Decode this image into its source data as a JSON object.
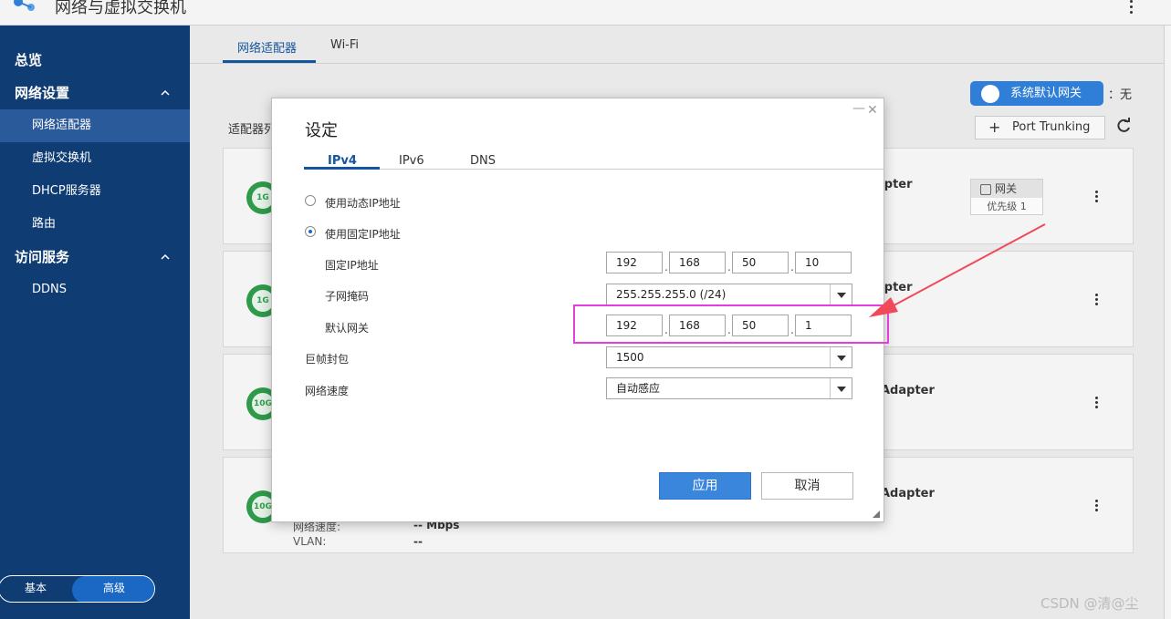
{
  "app": {
    "title": "网络与虚拟交换机"
  },
  "sidebar": {
    "items": [
      {
        "label": "总览"
      },
      {
        "label": "网络设置"
      },
      {
        "label": "网络适配器"
      },
      {
        "label": "虚拟交换机"
      },
      {
        "label": "DHCP服务器"
      },
      {
        "label": "路由"
      },
      {
        "label": "访问服务"
      },
      {
        "label": "DDNS"
      }
    ],
    "mode": {
      "basic": "基本",
      "advanced": "高级"
    }
  },
  "main": {
    "tabs": [
      {
        "label": "网络适配器"
      },
      {
        "label": "Wi-Fi"
      }
    ],
    "default_gateway_label": "系统默认网关",
    "default_gateway_value": "：无",
    "port_trunking_label": "Port Trunking",
    "list_title": "适配器列",
    "cards": [
      {
        "badge": "1G",
        "name": "apter",
        "chip_label": "网关",
        "chip_priority": "优先级 1"
      },
      {
        "badge": "1G",
        "name": "apter"
      },
      {
        "badge": "10G",
        "name": "Adapter"
      },
      {
        "badge": "10G",
        "name": "Adapter",
        "speed_label": "网络速度:",
        "speed_value": "-- Mbps",
        "vlan_label": "VLAN:",
        "vlan_value": "--"
      }
    ]
  },
  "modal": {
    "title": "设定",
    "tabs": [
      {
        "label": "IPv4"
      },
      {
        "label": "IPv6"
      },
      {
        "label": "DNS"
      }
    ],
    "options": {
      "dynamic": "使用动态IP地址",
      "static": "使用固定IP地址"
    },
    "fields": {
      "fixed_ip_label": "固定IP地址",
      "fixed_ip": [
        "192",
        "168",
        "50",
        "10"
      ],
      "subnet_label": "子网掩码",
      "subnet_value": "255.255.255.0 (/24)",
      "gateway_label": "默认网关",
      "gateway": [
        "192",
        "168",
        "50",
        "1"
      ],
      "jumbo_label": "巨帧封包",
      "jumbo_value": "1500",
      "speed_label": "网络速度",
      "speed_value": "自动感应"
    },
    "apply": "应用",
    "cancel": "取消"
  },
  "watermark": "CSDN @清@尘",
  "colors": {
    "sidebar": "#0f3c73",
    "accent": "#1a68c4",
    "highlight": "#e23fdc",
    "arrow": "#f04a5a"
  }
}
